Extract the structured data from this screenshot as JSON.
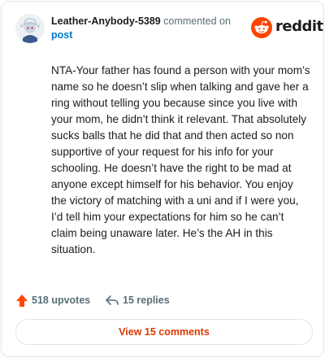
{
  "header": {
    "username": "Leather-Anybody-5389",
    "commented_on": "commented on",
    "post_link": "post",
    "brand_name": "reddit",
    "brand_color": "#ff4500"
  },
  "comment": {
    "text": "NTA-Your father has found a person with your mom’s name so he doesn’t slip when talking and gave her a ring without telling you because since you live with your mom, he didn’t think it relevant. That absolutely sucks balls that he did that and then acted so non supportive of your request for his info for your schooling. He doesn’t have the right to be mad at anyone except himself for his behavior. You enjoy the victory of matching with a uni and if I were you, I’d tell him your expectations for him so he can’t claim being unaware later. He’s the AH in this situation."
  },
  "actions": {
    "upvotes_label": "518 upvotes",
    "upvote_color": "#ff4500",
    "replies_label": "15 replies"
  },
  "footer": {
    "view_comments_label": "View 15 comments",
    "view_comments_color": "#d93a00"
  },
  "icons": [
    "user-avatar",
    "reddit-logo-icon",
    "upvote-arrow-icon",
    "reply-arrow-icon"
  ]
}
